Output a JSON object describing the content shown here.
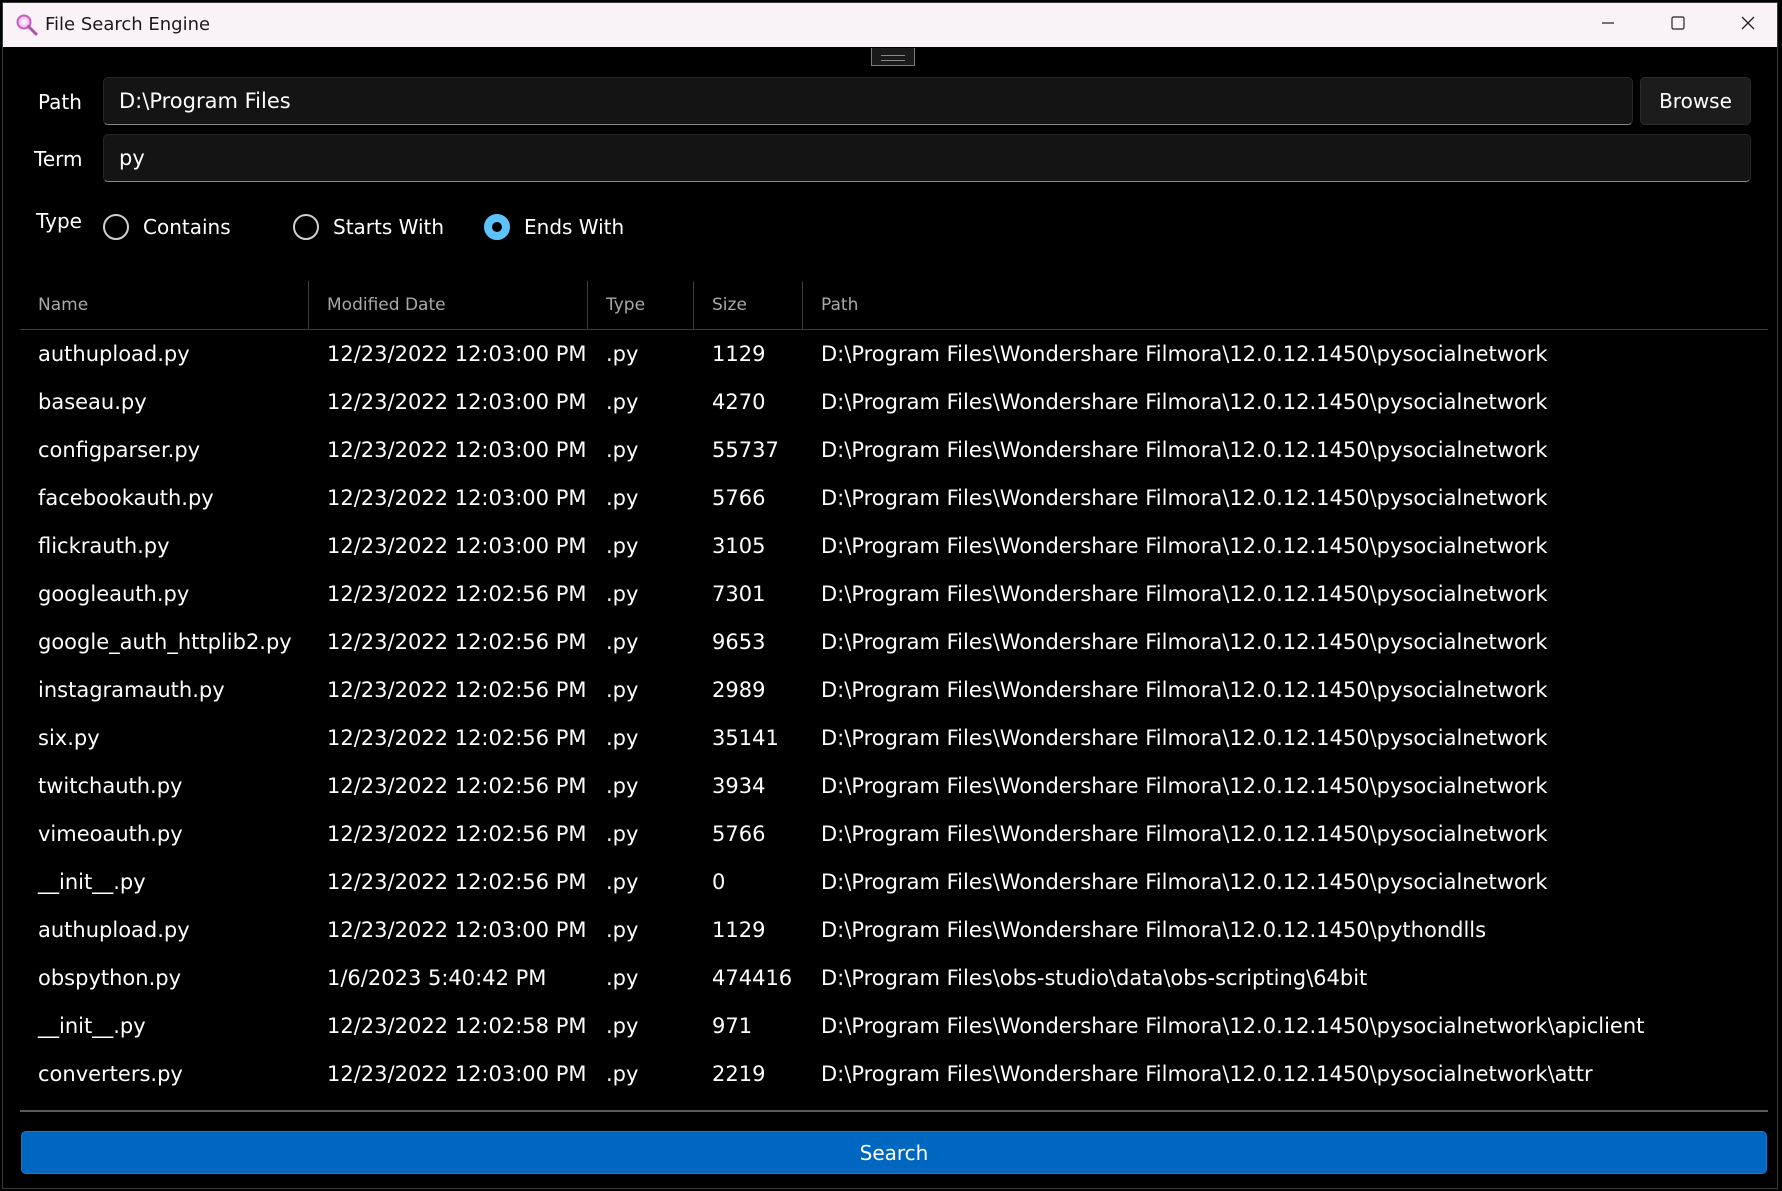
{
  "window": {
    "title": "File Search Engine",
    "controls": {
      "minimize": "minimize-icon",
      "maximize": "maximize-icon",
      "close": "close-icon"
    }
  },
  "form": {
    "path_label": "Path",
    "path_value": "D:\\Program Files",
    "browse_label": "Browse",
    "term_label": "Term",
    "term_value": "py",
    "type_label": "Type",
    "type_options": [
      {
        "label": "Contains",
        "selected": false
      },
      {
        "label": "Starts With",
        "selected": false
      },
      {
        "label": "Ends With",
        "selected": true
      }
    ]
  },
  "table": {
    "columns": [
      "Name",
      "Modified Date",
      "Type",
      "Size",
      "Path"
    ],
    "rows": [
      [
        "authupload.py",
        "12/23/2022 12:03:00 PM",
        ".py",
        "1129",
        "D:\\Program Files\\Wondershare Filmora\\12.0.12.1450\\pysocialnetwork"
      ],
      [
        "baseau.py",
        "12/23/2022 12:03:00 PM",
        ".py",
        "4270",
        "D:\\Program Files\\Wondershare Filmora\\12.0.12.1450\\pysocialnetwork"
      ],
      [
        "configparser.py",
        "12/23/2022 12:03:00 PM",
        ".py",
        "55737",
        "D:\\Program Files\\Wondershare Filmora\\12.0.12.1450\\pysocialnetwork"
      ],
      [
        "facebookauth.py",
        "12/23/2022 12:03:00 PM",
        ".py",
        "5766",
        "D:\\Program Files\\Wondershare Filmora\\12.0.12.1450\\pysocialnetwork"
      ],
      [
        "flickrauth.py",
        "12/23/2022 12:03:00 PM",
        ".py",
        "3105",
        "D:\\Program Files\\Wondershare Filmora\\12.0.12.1450\\pysocialnetwork"
      ],
      [
        "googleauth.py",
        "12/23/2022 12:02:56 PM",
        ".py",
        "7301",
        "D:\\Program Files\\Wondershare Filmora\\12.0.12.1450\\pysocialnetwork"
      ],
      [
        "google_auth_httplib2.py",
        "12/23/2022 12:02:56 PM",
        ".py",
        "9653",
        "D:\\Program Files\\Wondershare Filmora\\12.0.12.1450\\pysocialnetwork"
      ],
      [
        "instagramauth.py",
        "12/23/2022 12:02:56 PM",
        ".py",
        "2989",
        "D:\\Program Files\\Wondershare Filmora\\12.0.12.1450\\pysocialnetwork"
      ],
      [
        "six.py",
        "12/23/2022 12:02:56 PM",
        ".py",
        "35141",
        "D:\\Program Files\\Wondershare Filmora\\12.0.12.1450\\pysocialnetwork"
      ],
      [
        "twitchauth.py",
        "12/23/2022 12:02:56 PM",
        ".py",
        "3934",
        "D:\\Program Files\\Wondershare Filmora\\12.0.12.1450\\pysocialnetwork"
      ],
      [
        "vimeoauth.py",
        "12/23/2022 12:02:56 PM",
        ".py",
        "5766",
        "D:\\Program Files\\Wondershare Filmora\\12.0.12.1450\\pysocialnetwork"
      ],
      [
        "__init__.py",
        "12/23/2022 12:02:56 PM",
        ".py",
        "0",
        "D:\\Program Files\\Wondershare Filmora\\12.0.12.1450\\pysocialnetwork"
      ],
      [
        "authupload.py",
        "12/23/2022 12:03:00 PM",
        ".py",
        "1129",
        "D:\\Program Files\\Wondershare Filmora\\12.0.12.1450\\pythondlls"
      ],
      [
        "obspython.py",
        "1/6/2023 5:40:42 PM",
        ".py",
        "474416",
        "D:\\Program Files\\obs-studio\\data\\obs-scripting\\64bit"
      ],
      [
        "__init__.py",
        "12/23/2022 12:02:58 PM",
        ".py",
        "971",
        "D:\\Program Files\\Wondershare Filmora\\12.0.12.1450\\pysocialnetwork\\apiclient"
      ],
      [
        "converters.py",
        "12/23/2022 12:03:00 PM",
        ".py",
        "2219",
        "D:\\Program Files\\Wondershare Filmora\\12.0.12.1450\\pysocialnetwork\\attr"
      ]
    ]
  },
  "search_label": "Search",
  "colors": {
    "accent": "#0067c0",
    "radio_selected": "#5cc3ff",
    "titlebar_bg": "#f9f3f8",
    "background": "#000000"
  }
}
